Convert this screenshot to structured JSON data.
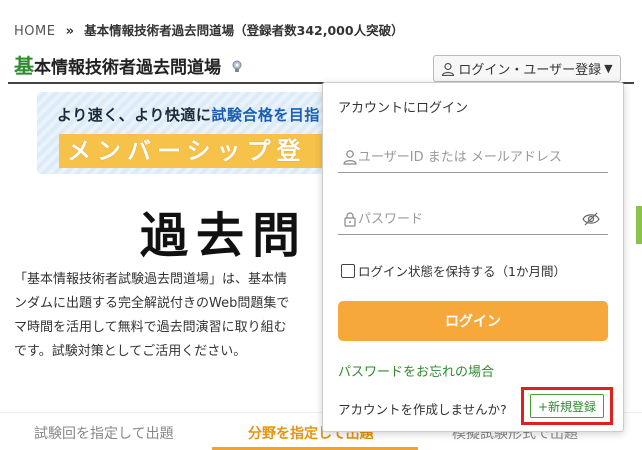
{
  "breadcrumb": {
    "home": "HOME",
    "separator": "»",
    "current": "基本情報技術者過去問道場（登録者数342,000人突破）"
  },
  "header": {
    "title_first_char": "基",
    "title_rest": "本情報技術者過去問道場",
    "login_button_label": "ログイン・ユーザー登録",
    "login_button_caret": "▼"
  },
  "banner": {
    "line1_a": "より速く、より快適に",
    "line1_b": "試験合格を目指",
    "line2": "メンバーシップ登"
  },
  "main": {
    "big_title": "過去問",
    "description": [
      "「基本情報技術者試験過去問道場」は、基本情",
      "ンダムに出題する完全解説付きのWeb問題集で",
      "マ時間を活用して無料で過去問演習に取り組む",
      "です。試験対策としてご活用ください。"
    ]
  },
  "tabs": [
    {
      "label": "試験回を指定して出題",
      "active": false
    },
    {
      "label": "分野を指定して出題",
      "active": true
    },
    {
      "label": "模擬試験形式で出題",
      "active": false
    }
  ],
  "login_dropdown": {
    "heading": "アカウントにログイン",
    "user_placeholder": "ユーザーID または メールアドレス",
    "password_placeholder": "パスワード",
    "remember_label": "ログイン状態を保持する（1か月間）",
    "submit_label": "ログイン",
    "forgot_link": "パスワードをお忘れの場合",
    "create_prompt": "アカウントを作成しませんか?",
    "register_button": "+新規登録"
  },
  "colors": {
    "accent_orange": "#f7a83a",
    "accent_green": "#2e8b2e",
    "highlight_red": "#e0201e",
    "banner_yellow": "#f6c24a"
  },
  "icons": [
    "user-icon",
    "lock-icon",
    "eye-icon",
    "trophy-icon",
    "caret-down-icon"
  ]
}
